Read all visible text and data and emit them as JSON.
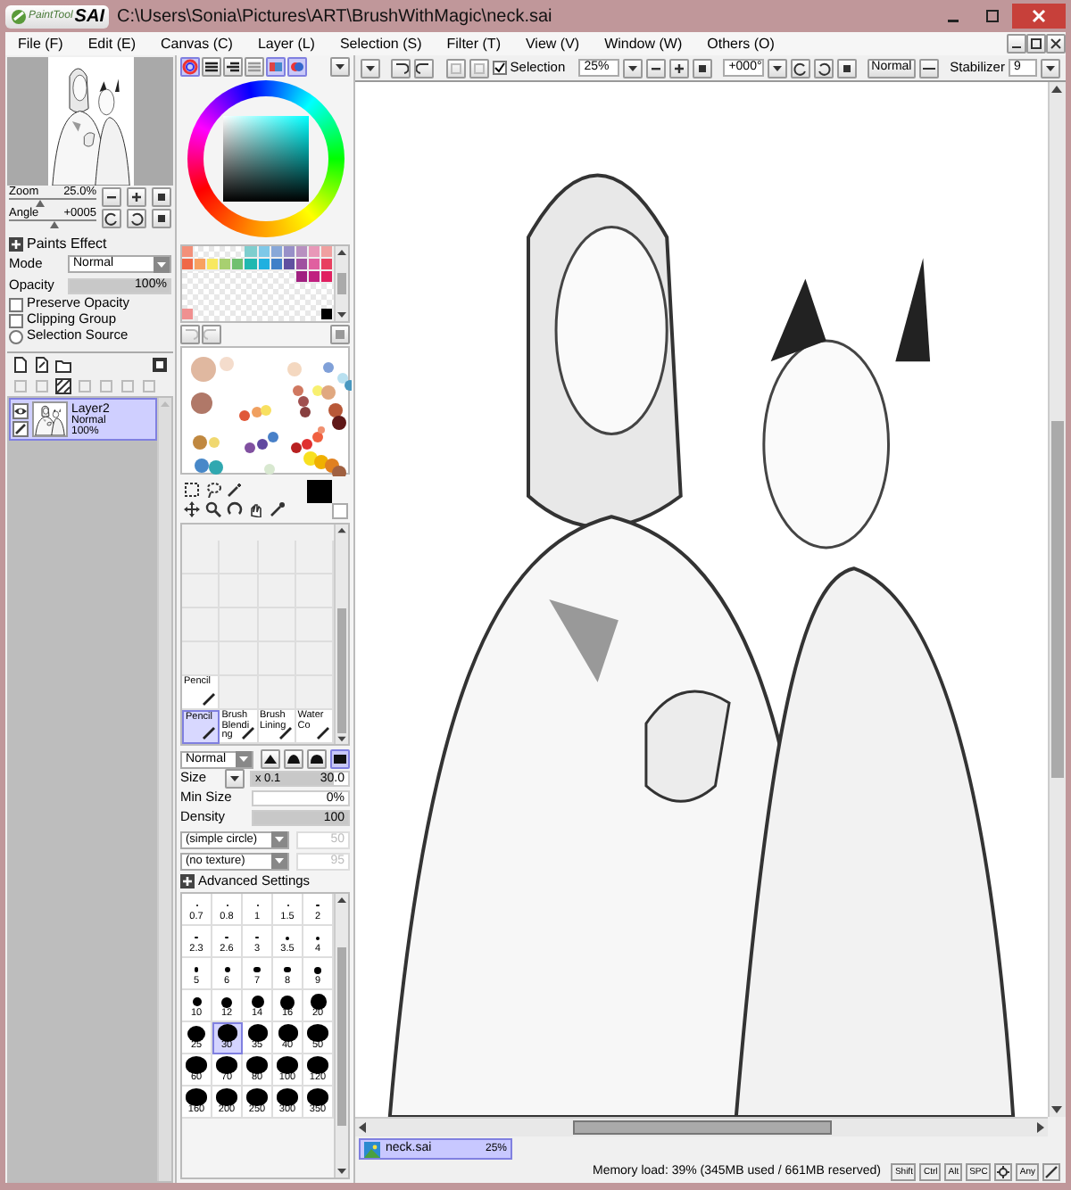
{
  "window": {
    "logo_small": "PaintTool",
    "logo_big": "SAI",
    "title": "C:\\Users\\Sonia\\Pictures\\ART\\BrushWithMagic\\neck.sai"
  },
  "menu": [
    "File (F)",
    "Edit (E)",
    "Canvas (C)",
    "Layer (L)",
    "Selection (S)",
    "Filter (T)",
    "View (V)",
    "Window (W)",
    "Others (O)"
  ],
  "navigator": {
    "zoom_label": "Zoom",
    "zoom": "25.0%",
    "zoom_slider": {
      "level": 0.35
    },
    "angle_label": "Angle",
    "angle": "+0005",
    "angle_slider": {
      "level": 0.5
    }
  },
  "paints_effect": {
    "title": "Paints Effect",
    "mode_label": "Mode",
    "mode": "Normal",
    "opacity_label": "Opacity",
    "opacity": "100%",
    "opacity_slider": {
      "level": 1
    },
    "options": [
      {
        "kind": "checkbox",
        "label": "Preserve Opacity",
        "checked": false
      },
      {
        "kind": "checkbox",
        "label": "Clipping Group",
        "checked": false
      },
      {
        "kind": "radio",
        "label": "Selection Source",
        "checked": false
      }
    ]
  },
  "layers": [
    {
      "name": "Layer2",
      "mode": "Normal",
      "opacity": "100%",
      "selected": true,
      "visible": true
    }
  ],
  "color_modes": [
    {
      "selected": true
    },
    {
      "selected": false
    },
    {
      "selected": false
    },
    {
      "selected": false
    },
    {
      "selected": true
    },
    {
      "selected": true
    }
  ],
  "swatch_rows": [
    [
      {
        "kind": "swatch",
        "color": "#f3907a"
      },
      {
        "kind": "empty"
      },
      {
        "kind": "empty"
      },
      {
        "kind": "empty"
      },
      {
        "kind": "empty"
      },
      {
        "kind": "swatch",
        "color": "#7ecece"
      },
      {
        "kind": "swatch",
        "color": "#7ec8e8"
      },
      {
        "kind": "swatch",
        "color": "#88a8d8"
      },
      {
        "kind": "swatch",
        "color": "#9890c8"
      },
      {
        "kind": "swatch",
        "color": "#b890c0"
      },
      {
        "kind": "swatch",
        "color": "#e898b8"
      },
      {
        "kind": "swatch",
        "color": "#f0a0a0"
      }
    ],
    [
      {
        "kind": "swatch",
        "color": "#f06848"
      },
      {
        "kind": "swatch",
        "color": "#f8a060"
      },
      {
        "kind": "swatch",
        "color": "#f8e860"
      },
      {
        "kind": "swatch",
        "color": "#a8d070"
      },
      {
        "kind": "swatch",
        "color": "#70c070"
      },
      {
        "kind": "swatch",
        "color": "#20b8b0"
      },
      {
        "kind": "swatch",
        "color": "#20b0e0"
      },
      {
        "kind": "swatch",
        "color": "#4080c8"
      },
      {
        "kind": "swatch",
        "color": "#6050a0"
      },
      {
        "kind": "swatch",
        "color": "#a050a0"
      },
      {
        "kind": "swatch",
        "color": "#e060a0"
      },
      {
        "kind": "swatch",
        "color": "#e84060"
      }
    ],
    [
      {
        "kind": "empty"
      },
      {
        "kind": "empty"
      },
      {
        "kind": "empty"
      },
      {
        "kind": "empty"
      },
      {
        "kind": "empty"
      },
      {
        "kind": "empty"
      },
      {
        "kind": "empty"
      },
      {
        "kind": "empty"
      },
      {
        "kind": "empty"
      },
      {
        "kind": "swatch",
        "color": "#a02080"
      },
      {
        "kind": "swatch",
        "color": "#c02080"
      },
      {
        "kind": "swatch",
        "color": "#e02060"
      }
    ],
    [
      {
        "kind": "empty"
      },
      {
        "kind": "empty"
      },
      {
        "kind": "empty"
      },
      {
        "kind": "empty"
      },
      {
        "kind": "empty"
      },
      {
        "kind": "empty"
      },
      {
        "kind": "empty"
      },
      {
        "kind": "empty"
      },
      {
        "kind": "empty"
      },
      {
        "kind": "empty"
      },
      {
        "kind": "empty"
      },
      {
        "kind": "empty"
      }
    ],
    [
      {
        "kind": "empty"
      },
      {
        "kind": "empty"
      },
      {
        "kind": "empty"
      },
      {
        "kind": "empty"
      },
      {
        "kind": "empty"
      },
      {
        "kind": "empty"
      },
      {
        "kind": "empty"
      },
      {
        "kind": "empty"
      },
      {
        "kind": "empty"
      },
      {
        "kind": "empty"
      },
      {
        "kind": "empty"
      },
      {
        "kind": "empty"
      }
    ],
    [
      {
        "kind": "swatch",
        "color": "#f09090"
      },
      {
        "kind": "empty"
      },
      {
        "kind": "empty"
      },
      {
        "kind": "empty"
      },
      {
        "kind": "empty"
      },
      {
        "kind": "empty"
      },
      {
        "kind": "empty"
      },
      {
        "kind": "empty"
      },
      {
        "kind": "empty"
      },
      {
        "kind": "empty"
      },
      {
        "kind": "empty"
      },
      {
        "kind": "swatch",
        "color": "#000000"
      }
    ]
  ],
  "primary_color": {
    "color": "#000000"
  },
  "tool_rows": [
    [
      {
        "label": "Pencil",
        "selected": false
      }
    ],
    [
      {
        "label": "Pencil",
        "selected": true
      },
      {
        "label": "Brush Blending",
        "selected": false
      },
      {
        "label": "Brush Lining",
        "selected": false
      },
      {
        "label": "WaterCo",
        "selected": false
      }
    ]
  ],
  "brush": {
    "blend": "Normal",
    "shapes": [
      {
        "selected": false
      },
      {
        "selected": false
      },
      {
        "selected": false
      },
      {
        "selected": true
      }
    ],
    "size_label": "Size",
    "size_multiplier": "x 0.1",
    "size": "30.0",
    "size_slider": {
      "level": 0.85
    },
    "min_size_label": "Min Size",
    "min_size": "0%",
    "min_size_slider": {
      "level": 0
    },
    "density_label": "Density",
    "density": "100",
    "density_slider": {
      "level": 1
    },
    "shape": "(simple circle)",
    "shape_value": "50",
    "texture": "(no texture)",
    "texture_value": "95",
    "advanced": "Advanced Settings"
  },
  "size_presets": [
    {
      "label": "0.7",
      "selected": false
    },
    {
      "label": "0.8",
      "selected": false
    },
    {
      "label": "1",
      "selected": false
    },
    {
      "label": "1.5",
      "selected": false
    },
    {
      "label": "2",
      "selected": false
    },
    {
      "label": "2.3",
      "selected": false
    },
    {
      "label": "2.6",
      "selected": false
    },
    {
      "label": "3",
      "selected": false
    },
    {
      "label": "3.5",
      "selected": false
    },
    {
      "label": "4",
      "selected": false
    },
    {
      "label": "5",
      "selected": false
    },
    {
      "label": "6",
      "selected": false
    },
    {
      "label": "7",
      "selected": false
    },
    {
      "label": "8",
      "selected": false
    },
    {
      "label": "9",
      "selected": false
    },
    {
      "label": "10",
      "selected": false
    },
    {
      "label": "12",
      "selected": false
    },
    {
      "label": "14",
      "selected": false
    },
    {
      "label": "16",
      "selected": false
    },
    {
      "label": "20",
      "selected": false
    },
    {
      "label": "25",
      "selected": false
    },
    {
      "label": "30",
      "selected": true
    },
    {
      "label": "35",
      "selected": false
    },
    {
      "label": "40",
      "selected": false
    },
    {
      "label": "50",
      "selected": false
    },
    {
      "label": "60",
      "selected": false
    },
    {
      "label": "70",
      "selected": false
    },
    {
      "label": "80",
      "selected": false
    },
    {
      "label": "100",
      "selected": false
    },
    {
      "label": "120",
      "selected": false
    },
    {
      "label": "160",
      "selected": false
    },
    {
      "label": "200",
      "selected": false
    },
    {
      "label": "250",
      "selected": false
    },
    {
      "label": "300",
      "selected": false
    },
    {
      "label": "350",
      "selected": false
    }
  ],
  "canvas_toolbar": {
    "selection_label": "Selection",
    "selection_checked": true,
    "zoom": "25%",
    "angle": "+000°",
    "blend": "Normal",
    "stabilizer_label": "Stabilizer",
    "stabilizer": "9"
  },
  "documents": [
    {
      "name": "neck.sai",
      "zoom": "25%",
      "selected": true
    }
  ],
  "status_bar": {
    "memory": "Memory load: 39% (345MB used / 661MB reserved)",
    "keys": [
      "Shift",
      "Ctrl",
      "Alt",
      "SPC",
      "Any"
    ]
  }
}
